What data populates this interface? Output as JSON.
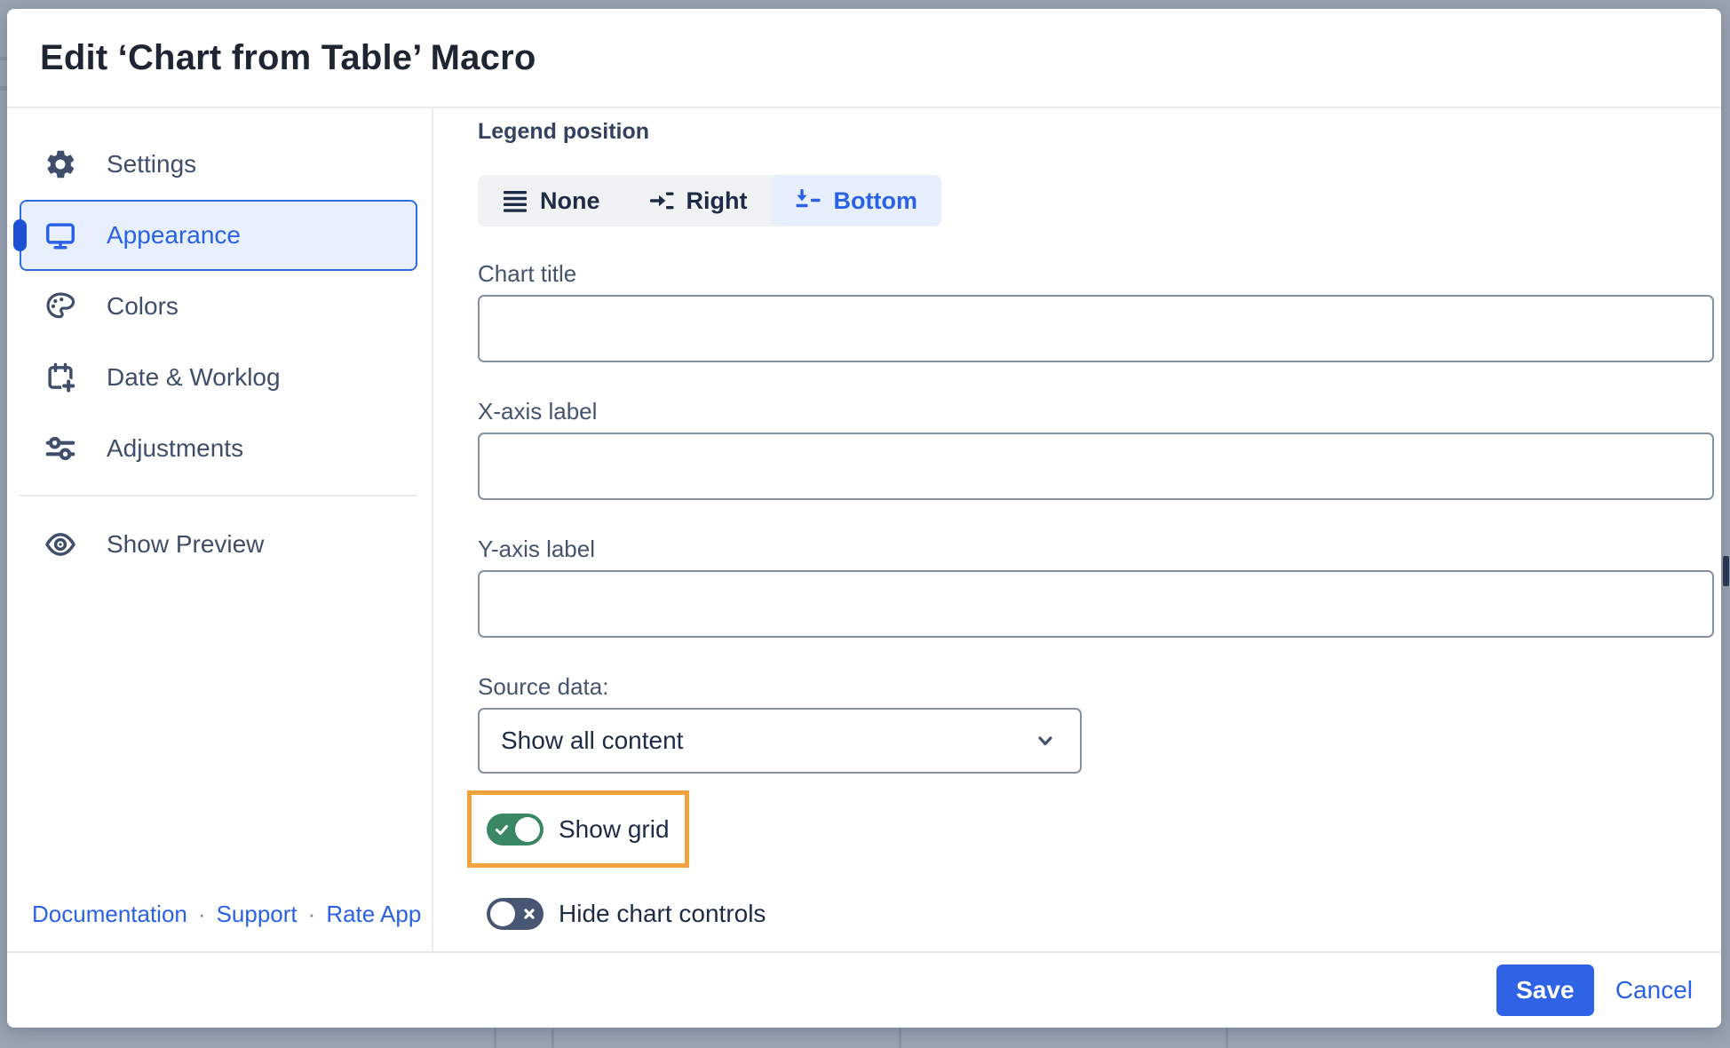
{
  "modal": {
    "title": "Edit ‘Chart from Table’ Macro",
    "sidebar": {
      "items": [
        {
          "label": "Settings",
          "icon": "gear-icon",
          "selected": false
        },
        {
          "label": "Appearance",
          "icon": "monitor-icon",
          "selected": true
        },
        {
          "label": "Colors",
          "icon": "palette-icon",
          "selected": false
        },
        {
          "label": "Date & Worklog",
          "icon": "calendar-plus-icon",
          "selected": false
        },
        {
          "label": "Adjustments",
          "icon": "sliders-icon",
          "selected": false
        }
      ],
      "preview": {
        "label": "Show Preview",
        "icon": "eye-icon"
      },
      "links": [
        {
          "label": "Documentation"
        },
        {
          "label": "Support"
        },
        {
          "label": "Rate App"
        }
      ],
      "link_separator": "·"
    },
    "content": {
      "legend": {
        "label": "Legend position",
        "options": [
          {
            "label": "None",
            "icon": "legend-none-icon",
            "selected": false
          },
          {
            "label": "Right",
            "icon": "legend-right-icon",
            "selected": false
          },
          {
            "label": "Bottom",
            "icon": "legend-bottom-icon",
            "selected": true
          }
        ]
      },
      "fields": [
        {
          "label": "Chart title",
          "value": ""
        },
        {
          "label": "X-axis label",
          "value": ""
        },
        {
          "label": "Y-axis label",
          "value": ""
        }
      ],
      "source_data": {
        "label": "Source data:",
        "selected_option": "Show all content"
      },
      "toggles": [
        {
          "label": "Show grid",
          "state": "on",
          "highlighted": true
        },
        {
          "label": "Hide chart controls",
          "state": "off",
          "highlighted": false
        }
      ]
    },
    "footer": {
      "save_label": "Save",
      "cancel_label": "Cancel"
    }
  },
  "colors": {
    "accent_blue": "#2a62e5",
    "selected_item_bg": "#e9f0fd",
    "selected_item_border": "#2f6be3",
    "segment_selected_bg": "#e7eefc",
    "toggle_on_green": "#3a8763",
    "toggle_off_slate": "#475672",
    "highlight_orange": "#f0a33d",
    "text_dark_navy": "#1d2b47",
    "text_slate": "#44546f",
    "page_background": "#9aa3b1"
  }
}
